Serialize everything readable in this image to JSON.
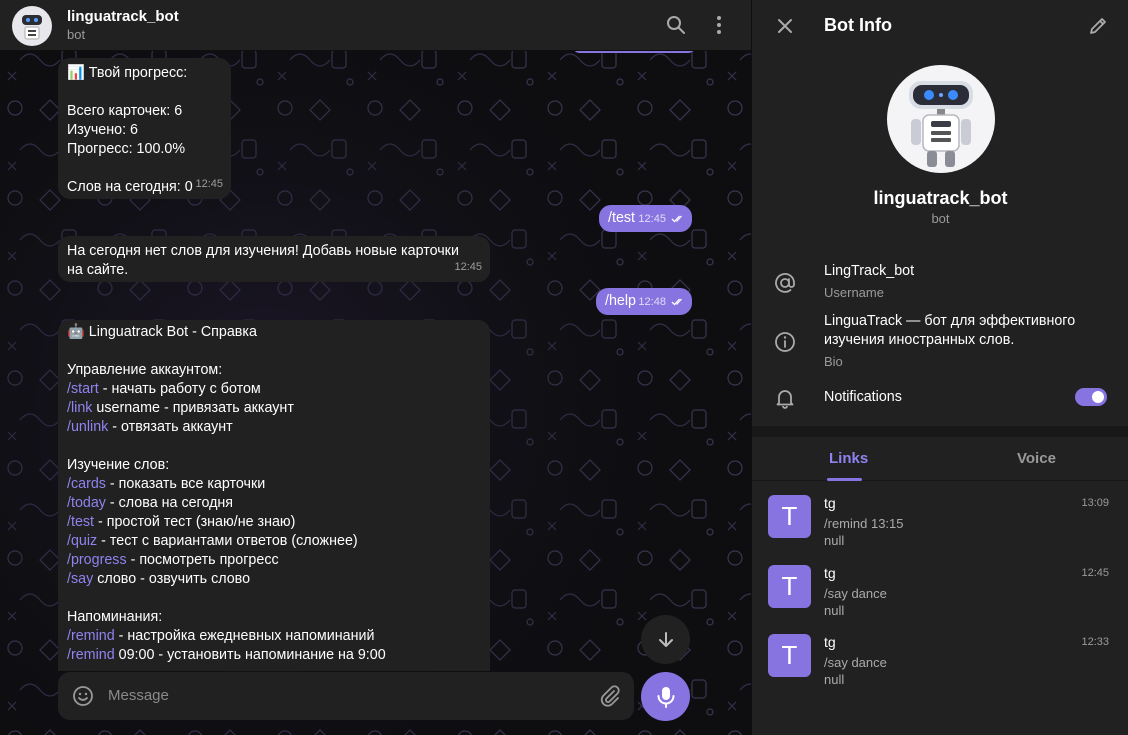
{
  "chat": {
    "title": "linguatrack_bot",
    "subtitle": "bot",
    "composer_placeholder": "Message",
    "messages": [
      {
        "lines": [
          "📊 Твой прогресс:",
          "",
          "Всего карточек: 6",
          "Изучено: 6",
          "Прогресс: 100.0%",
          "",
          "Слов на сегодня: 0"
        ],
        "time": "12:45"
      },
      {
        "text": "/test",
        "time": "12:45"
      },
      {
        "lines": [
          "На сегодня нет слов для изучения! Добавь новые карточки",
          "на сайте."
        ],
        "time": "12:45"
      },
      {
        "text": "/help",
        "time": "12:48"
      },
      {
        "title": "🤖 Linguatrack Bot - Справка",
        "sections": [
          {
            "heading": "Управление аккаунтом:",
            "items": [
              {
                "cmd": "/start",
                "rest": " - начать работу с ботом"
              },
              {
                "cmd": "/link",
                "rest": " username - привязать аккаунт"
              },
              {
                "cmd": "/unlink",
                "rest": " - отвязать аккаунт"
              }
            ]
          },
          {
            "heading": "Изучение слов:",
            "items": [
              {
                "cmd": "/cards",
                "rest": " - показать все карточки"
              },
              {
                "cmd": "/today",
                "rest": " - слова на сегодня"
              },
              {
                "cmd": "/test",
                "rest": " - простой тест (знаю/не знаю)"
              },
              {
                "cmd": "/quiz",
                "rest": " - тест с вариантами ответов (сложнее)"
              },
              {
                "cmd": "/progress",
                "rest": " - посмотреть прогресс"
              },
              {
                "cmd": "/say",
                "rest": " слово - озвучить слово"
              }
            ]
          },
          {
            "heading": "Напоминания:",
            "items": [
              {
                "cmd": "/remind",
                "rest": " - настройка ежедневных напоминаний"
              },
              {
                "cmd": "/remind",
                "rest": " 09:00 - установить напоминание на 9:00"
              }
            ]
          }
        ]
      }
    ]
  },
  "panel": {
    "title": "Bot Info",
    "name": "linguatrack_bot",
    "subtitle": "bot",
    "username": {
      "value": "LingTrack_bot",
      "label": "Username"
    },
    "bio": {
      "value": "LinguaTrack — бот для эффективного изучения иностранных слов.",
      "label": "Bio"
    },
    "notifications": {
      "label": "Notifications",
      "enabled": true
    },
    "tabs": [
      {
        "label": "Links",
        "active": true
      },
      {
        "label": "Voice",
        "active": false
      }
    ],
    "links": [
      {
        "initial": "T",
        "title": "tg",
        "url": "/remind 13:15",
        "desc": "null",
        "time": "13:09"
      },
      {
        "initial": "T",
        "title": "tg",
        "url": "/say dance",
        "desc": "null",
        "time": "12:45"
      },
      {
        "initial": "T",
        "title": "tg",
        "url": "/say dance",
        "desc": "null",
        "time": "12:33"
      }
    ]
  },
  "colors": {
    "accent": "#8774e1",
    "panel_bg": "#212121",
    "chat_bg": "#0e0e11",
    "command": "#8f83ef"
  },
  "icons": [
    "search-icon",
    "more-vertical-icon",
    "close-icon",
    "edit-pencil-icon",
    "at-sign-icon",
    "info-icon",
    "bell-icon",
    "emoji-icon",
    "paperclip-icon",
    "microphone-icon",
    "arrow-down-icon",
    "double-check-icon"
  ]
}
